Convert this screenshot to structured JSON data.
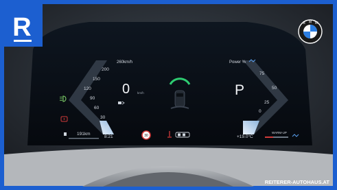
{
  "brand": {
    "logo_letter": "R",
    "watermark": "REITERER-AUTOHAUS.AT",
    "bmw_letters": [
      "B",
      "M",
      "W"
    ]
  },
  "speedometer": {
    "unit": "km/h",
    "current": 0,
    "current_unit": "km/h",
    "ticks": [
      "0",
      "30",
      "60",
      "90",
      "120",
      "150",
      "200",
      "260km/h"
    ]
  },
  "power_gauge": {
    "title": "Power %",
    "ticks": [
      "0",
      "25",
      "50",
      "75"
    ],
    "gear": "P"
  },
  "bottom_left": {
    "range": "191km",
    "time": "8:21"
  },
  "bottom_center": {
    "speed_limit": "30"
  },
  "bottom_right": {
    "temperature": "+19.0°C",
    "warmup_label": "WARM-UP"
  },
  "colors": {
    "accent_blue": "#1c5fd0",
    "gauge_fill": "#c2d7ea",
    "indicator_green": "#2ecc71",
    "warning_red": "#d23b3b"
  },
  "icons": [
    "eco-mode-icon",
    "headlight-icon",
    "warning-icon",
    "fuel-icon",
    "speed-limit-sign-icon",
    "driver-assist-icon",
    "car-icon",
    "bmw-logo-icon",
    "coolant-icon"
  ]
}
